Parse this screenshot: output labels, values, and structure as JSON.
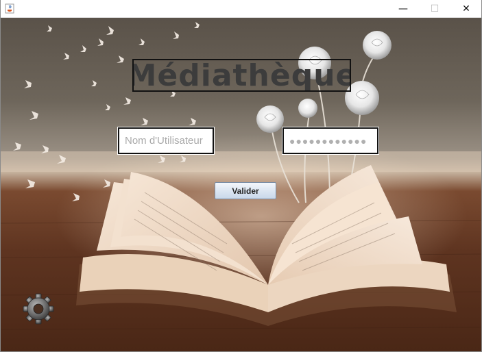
{
  "window": {
    "title": "",
    "minimize_glyph": "—",
    "maximize_glyph": "☐",
    "close_glyph": "✕",
    "app_icon": "java-cup-icon"
  },
  "main": {
    "title": "Médiathèque",
    "username_placeholder": "Nom d'Utilisateur",
    "password_value": "●●●●●●●●●●●●",
    "submit_label": "Valider",
    "settings_icon": "gear-icon",
    "background_image": "open-book-with-butterflies-and-roses"
  },
  "colors": {
    "title_text": "#3c3c3c",
    "field_border": "#111111",
    "button_top": "#f4f7fb",
    "button_bottom": "#c9d8ea"
  }
}
